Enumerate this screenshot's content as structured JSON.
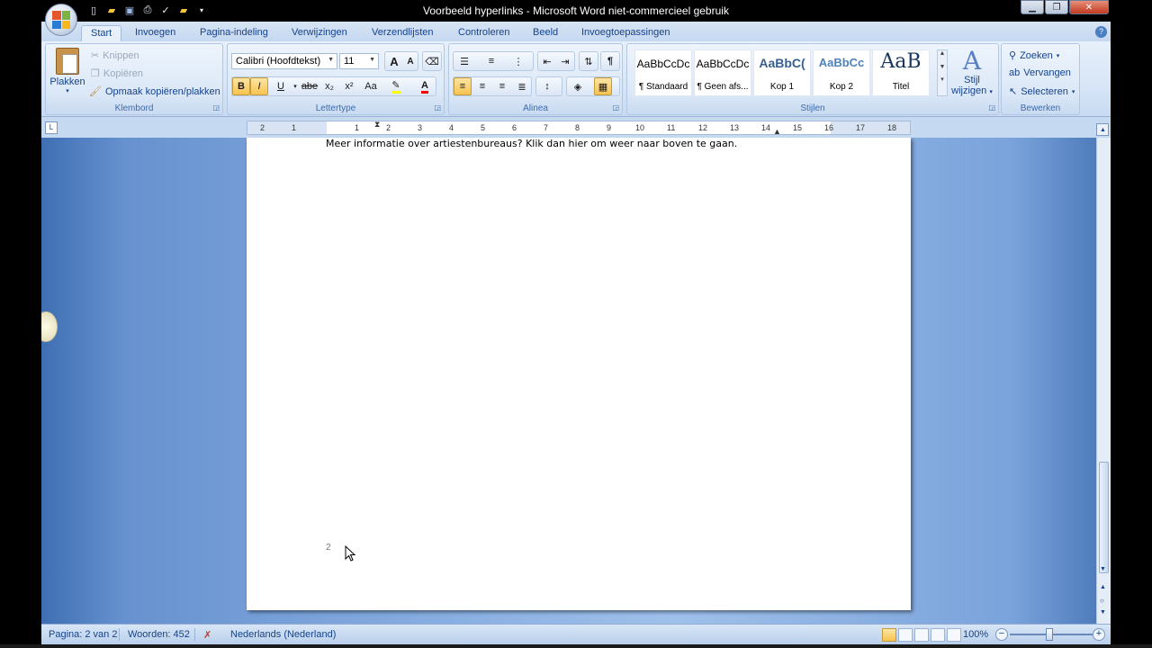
{
  "window": {
    "title": "Voorbeeld hyperlinks - Microsoft Word niet-commercieel gebruik"
  },
  "quick_access": [
    "new-icon",
    "open-icon",
    "save-icon",
    "print-preview-icon",
    "spelling-icon",
    "folder-icon"
  ],
  "tabs": [
    {
      "label": "Start",
      "active": true
    },
    {
      "label": "Invoegen"
    },
    {
      "label": "Pagina-indeling"
    },
    {
      "label": "Verwijzingen"
    },
    {
      "label": "Verzendlijsten"
    },
    {
      "label": "Controleren"
    },
    {
      "label": "Beeld"
    },
    {
      "label": "Invoegtoepassingen"
    }
  ],
  "ribbon": {
    "clipboard": {
      "group_label": "Klembord",
      "paste_label": "Plakken",
      "cut_label": "Knippen",
      "copy_label": "Kopiëren",
      "format_painter_label": "Opmaak kopiëren/plakken"
    },
    "font": {
      "group_label": "Lettertype",
      "font_name": "Calibri (Hoofdtekst)",
      "font_size": "11",
      "bold": "B",
      "italic": "I",
      "underline": "U",
      "strike": "abe",
      "subscript": "x₂",
      "superscript": "x²",
      "change_case": "Aa",
      "grow": "A",
      "shrink": "A",
      "font_color_label": "A",
      "highlight_color": "#ffff00",
      "font_color": "#ff0000"
    },
    "paragraph": {
      "group_label": "Alinea",
      "pilcrow": "¶"
    },
    "styles": {
      "group_label": "Stijlen",
      "items": [
        {
          "sample": "AaBbCcDc",
          "name": "¶ Standaard"
        },
        {
          "sample": "AaBbCcDc",
          "name": "¶ Geen afs..."
        },
        {
          "sample": "AaBbC(",
          "name": "Kop 1"
        },
        {
          "sample": "AaBbCc",
          "name": "Kop 2"
        },
        {
          "sample": "AaB",
          "name": "Titel"
        }
      ],
      "change_style_label_1": "Stijl",
      "change_style_label_2": "wijzigen"
    },
    "editing": {
      "group_label": "Bewerken",
      "find_label": "Zoeken",
      "replace_label": "Vervangen",
      "select_label": "Selecteren"
    }
  },
  "ruler": {
    "toggle": "L",
    "ticks_left": [
      "2",
      "1"
    ],
    "ticks_main": [
      "1",
      "2",
      "3",
      "4",
      "5",
      "6",
      "7",
      "8",
      "9",
      "10",
      "11",
      "12",
      "13",
      "14",
      "15",
      "16",
      "17",
      "18"
    ]
  },
  "document": {
    "line1": "Meer informatie over artiestenbureaus? Klik dan hier om weer naar boven te gaan.",
    "page_number": "2"
  },
  "statusbar": {
    "page": "Pagina: 2 van 2",
    "words": "Woorden: 452",
    "language": "Nederlands (Nederland)",
    "zoom": "100%",
    "zoom_level_percent": 100
  }
}
